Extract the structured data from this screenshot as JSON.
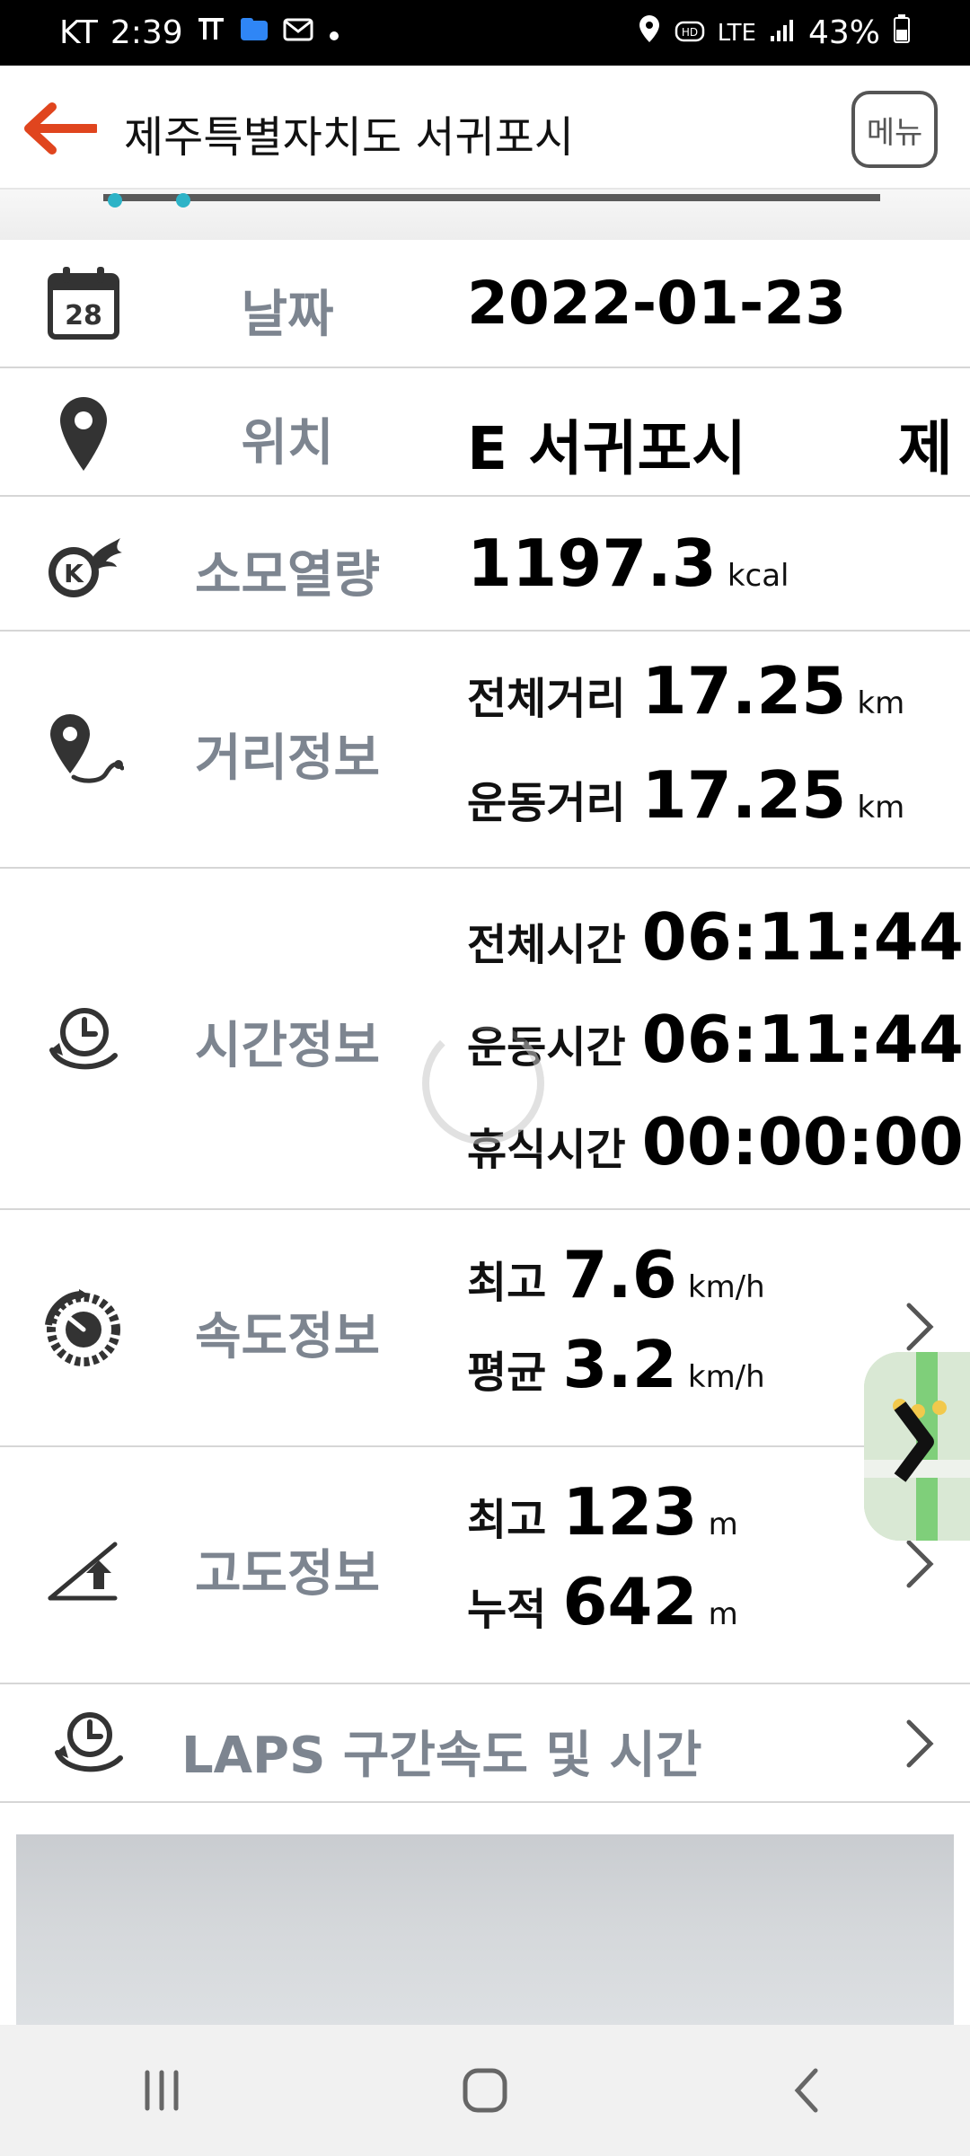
{
  "status_bar": {
    "carrier": "KT",
    "time": "2:39",
    "network": "LTE",
    "battery": "43%"
  },
  "header": {
    "title": "제주특별자치도 서귀포시",
    "menu_label": "메뉴"
  },
  "rows": {
    "date": {
      "label": "날짜",
      "value": "2022-01-23",
      "icon_day": "28"
    },
    "location": {
      "label": "위치",
      "value": "E 서귀포시",
      "value_next": "제"
    },
    "calories": {
      "label": "소모열량",
      "value": "1197.3",
      "unit": "kcal"
    },
    "distance": {
      "label": "거리정보",
      "total_label": "전체거리",
      "total_value": "17.25",
      "total_unit": "km",
      "exercise_label": "운동거리",
      "exercise_value": "17.25",
      "exercise_unit": "km"
    },
    "time": {
      "label": "시간정보",
      "total_label": "전체시간",
      "total_value": "06:11:44",
      "exercise_label": "운동시간",
      "exercise_value": "06:11:44",
      "rest_label": "휴식시간",
      "rest_value": "00:00:00"
    },
    "speed": {
      "label": "속도정보",
      "max_label": "최고",
      "max_value": "7.6",
      "max_unit": "km/h",
      "avg_label": "평균",
      "avg_value": "3.2",
      "avg_unit": "km/h"
    },
    "altitude": {
      "label": "고도정보",
      "max_label": "최고",
      "max_value": "123",
      "max_unit": "m",
      "cum_label": "누적",
      "cum_value": "642",
      "cum_unit": "m"
    },
    "laps": {
      "label": "LAPS 구간속도 및 시간"
    }
  },
  "colors": {
    "accent": "#e0451e",
    "label_gray": "#7d8590",
    "divider": "#d6d6d6"
  },
  "icons": {
    "back": "arrow-left-icon",
    "calendar": "calendar-icon",
    "location": "map-pin-icon",
    "calories": "flame-icon",
    "distance": "route-pin-icon",
    "time": "clock-cycle-icon",
    "speed": "speedometer-icon",
    "altitude": "elevation-icon",
    "laps": "laps-clock-icon",
    "chevron": "chevron-right-icon"
  }
}
